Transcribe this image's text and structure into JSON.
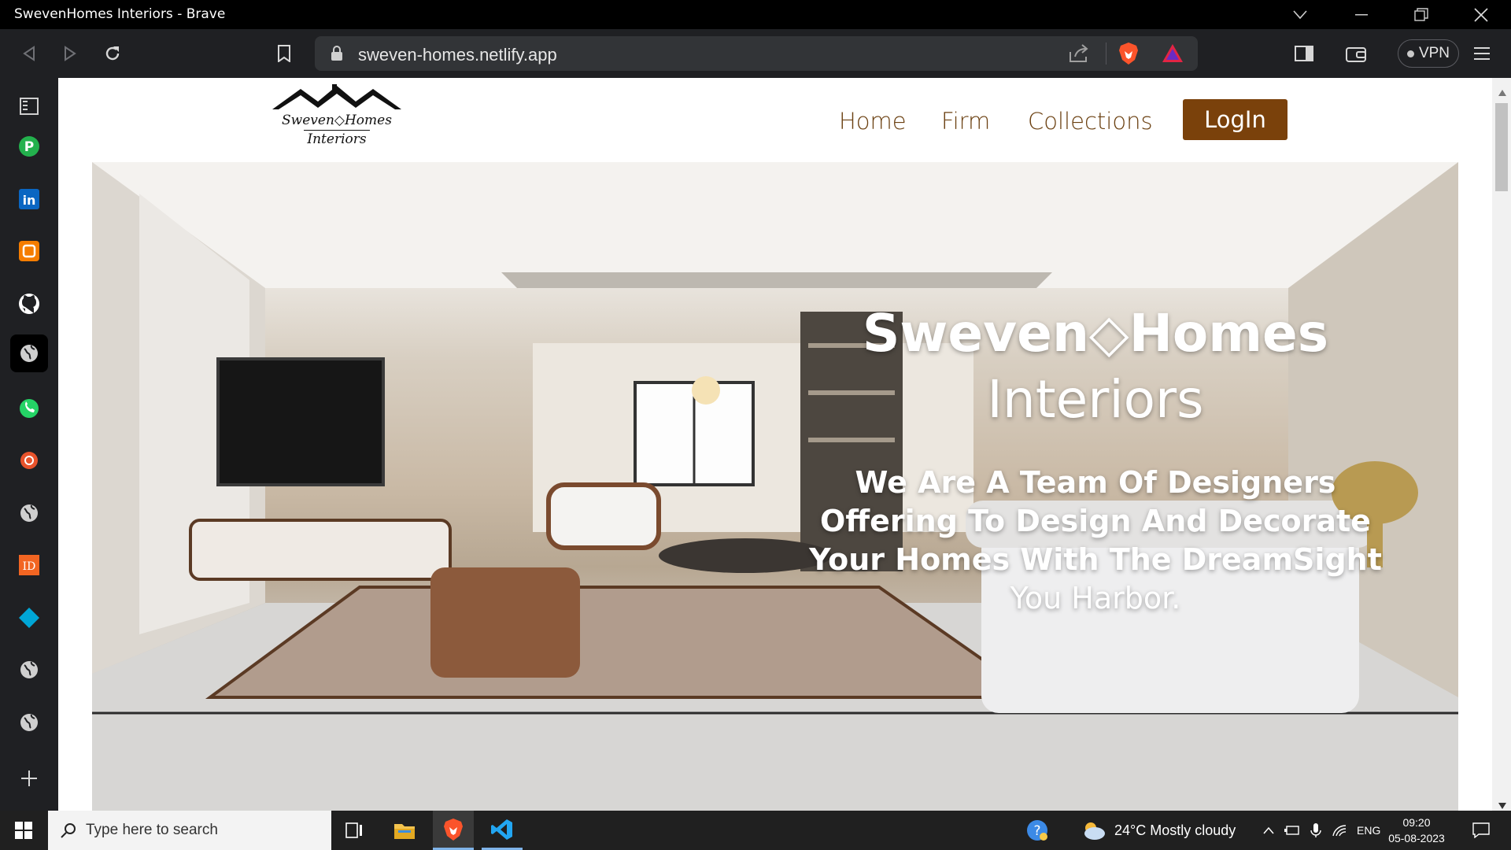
{
  "window": {
    "title": "SwevenHomes Interiors - Brave"
  },
  "toolbar": {
    "url": "sweven-homes.netlify.app",
    "vpn_label": "VPN"
  },
  "sidebar": {
    "items": [
      "p-app-icon",
      "linkedin-icon",
      "blogger-icon",
      "github-icon",
      "globe-icon",
      "whatsapp-icon",
      "record-icon",
      "globe-icon",
      "id-icon",
      "diamond-icon",
      "globe-icon",
      "globe-icon",
      "add-icon"
    ]
  },
  "site": {
    "logo_line1": "Sweven◇Homes",
    "logo_line2": "Interiors",
    "nav": {
      "home": "Home",
      "firm": "Firm",
      "collections": "Collections",
      "login": "LogIn"
    },
    "hero": {
      "title_line1": "Sweven◇Homes",
      "title_line2": "Interiors",
      "tagline1": "We Are A Team Of Designers",
      "tagline2": "Offering To Design And Decorate",
      "tagline3": "Your Homes With The DreamSight",
      "tagline4": "You Harbor."
    }
  },
  "taskbar": {
    "search_placeholder": "Type here to search",
    "weather": "24°C  Mostly cloudy",
    "lang": "ENG",
    "time": "09:20",
    "date": "05-08-2023"
  },
  "colors": {
    "brand_brown": "#7a410b",
    "nav_text": "#6b4011"
  }
}
